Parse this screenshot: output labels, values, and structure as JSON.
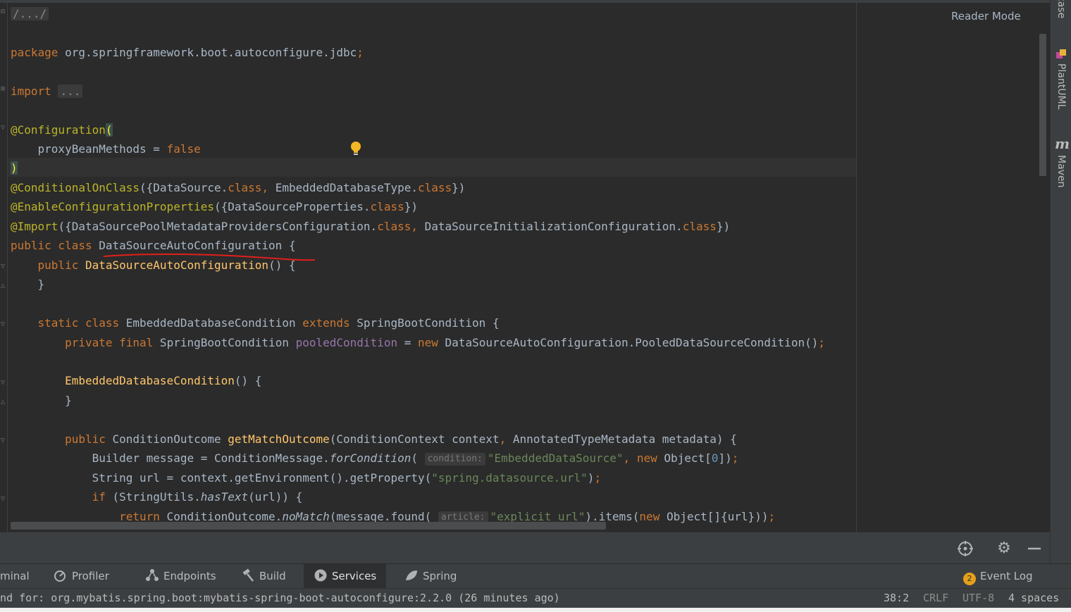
{
  "editor": {
    "reader_mode": "Reader Mode",
    "lines": [
      "/.../",
      "",
      "package org.springframework.boot.autoconfigure.jdbc;",
      "",
      "import ...",
      "",
      "@Configuration(",
      "    proxyBeanMethods = false",
      ")",
      "@ConditionalOnClass({DataSource.class, EmbeddedDatabaseType.class})",
      "@EnableConfigurationProperties({DataSourceProperties.class})",
      "@Import({DataSourcePoolMetadataProvidersConfiguration.class, DataSourceInitializationConfiguration.class})",
      "public class DataSourceAutoConfiguration {",
      "    public DataSourceAutoConfiguration() {",
      "    }",
      "",
      "    static class EmbeddedDatabaseCondition extends SpringBootCondition {",
      "        private final SpringBootCondition pooledCondition = new DataSourceAutoConfiguration.PooledDataSourceCondition();",
      "",
      "        EmbeddedDatabaseCondition() {",
      "        }",
      "",
      "        public ConditionOutcome getMatchOutcome(ConditionContext context, AnnotatedTypeMetadata metadata) {",
      "            Builder message = ConditionMessage.forCondition( condition: \"EmbeddedDataSource\", new Object[0]);",
      "            String url = context.getEnvironment().getProperty(\"spring.datasource.url\");",
      "            if (StringUtils.hasText(url)) {",
      "                return ConditionOutcome.noMatch(message.found( article: \"explicit url\").items(new Object[]{url}));"
    ]
  },
  "right_toolstrip": {
    "top_partial": "case",
    "plantuml": "PlantUML",
    "maven": "Maven"
  },
  "tool_tabs": {
    "terminal": "minal",
    "profiler": "Profiler",
    "endpoints": "Endpoints",
    "build": "Build",
    "services": "Services",
    "spring": "Spring",
    "event_log": "Event Log",
    "event_log_count": "2"
  },
  "status": {
    "message": "nd for: org.mybatis.spring.boot:mybatis-spring-boot-autoconfigure:2.2.0 (26 minutes ago)",
    "position": "38:2",
    "line_sep": "CRLF",
    "encoding": "UTF-8",
    "indent": "4 spaces"
  },
  "icons": {
    "bulb": "lightbulb-icon",
    "crosshair": "locate-icon",
    "gear": "gear-icon",
    "minimize": "minimize-icon",
    "profiler": "profiler-icon",
    "endpoints": "endpoints-icon",
    "build": "hammer-icon",
    "services": "services-icon",
    "spring": "spring-leaf-icon",
    "plantuml": "plantuml-icon",
    "maven": "maven-icon"
  },
  "colors": {
    "keyword": "#cc7832",
    "annotation": "#bbb529",
    "function": "#ffc66d",
    "string": "#6a8759",
    "number": "#6897bb",
    "field": "#9876aa",
    "text": "#a9b7c6",
    "background": "#2b2b2b",
    "underline": "#e0201b"
  }
}
